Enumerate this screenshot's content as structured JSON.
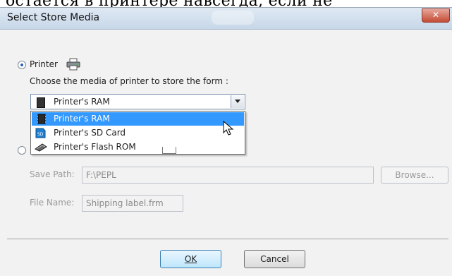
{
  "window": {
    "title": "Select Store Media",
    "close_glyph": "✕",
    "top_cut_text": "остается в принтере навсегда, если не"
  },
  "printer_option": {
    "label": "Printer",
    "selected": true,
    "icon": "printer-icon",
    "prompt": "Choose the media of printer to store the form :"
  },
  "media_combo": {
    "value": "Printer's RAM",
    "icon": "ram-chip-icon",
    "options": [
      {
        "label": "Printer's RAM",
        "icon": "ram-chip-icon",
        "selected": true
      },
      {
        "label": "Printer's SD Card",
        "icon": "sd-card-icon",
        "selected": false
      },
      {
        "label": "Printer's Flash ROM",
        "icon": "flash-rom-icon",
        "selected": false
      }
    ]
  },
  "pc_option": {
    "selected": false,
    "save_path_label": "Save Path:",
    "save_path_value": "F:\\PEPL",
    "browse_label": "Browse...",
    "file_name_label": "File Name:",
    "file_name_value": "Shipping label.frm"
  },
  "buttons": {
    "ok_label": "OK",
    "cancel_label": "Cancel"
  },
  "colors": {
    "selection": "#3399ff",
    "title_bar": "#c7d7e8",
    "close_button": "#c44b35"
  }
}
